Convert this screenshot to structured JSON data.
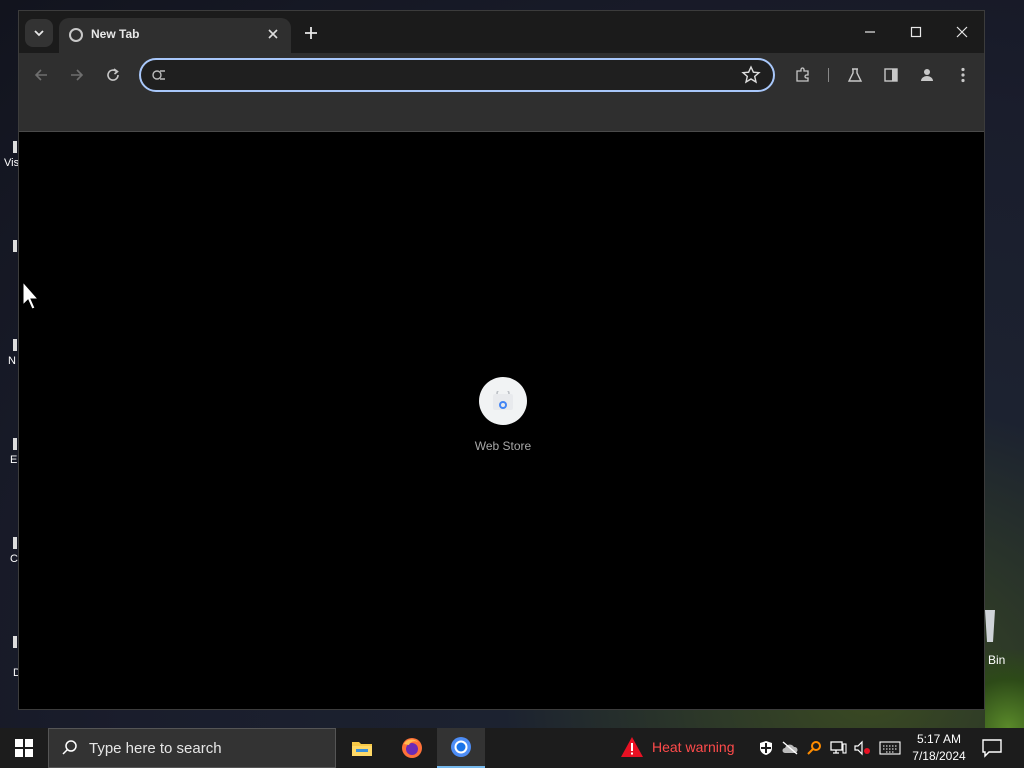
{
  "desktop": {
    "left_labels": [
      "Vis",
      "N",
      "E",
      "C",
      "D"
    ],
    "recycle_bin_label": "Bin"
  },
  "browser": {
    "tab": {
      "title": "New Tab",
      "close_icon": "close-icon"
    },
    "window_controls": [
      "minimize",
      "maximize",
      "close"
    ],
    "omnibox": {
      "value": "",
      "placeholder": ""
    },
    "new_tab_page": {
      "shortcuts": [
        {
          "label": "Web Store"
        }
      ]
    }
  },
  "taskbar": {
    "search_placeholder": "Type here to search",
    "apps": [
      "File Explorer",
      "Firefox",
      "Chrome"
    ],
    "weather": {
      "label": "Heat warning",
      "color": "#ff4b4b"
    },
    "clock": {
      "time": "5:17 AM",
      "date": "7/18/2024"
    }
  },
  "colors": {
    "omnibox_focus": "#a8c7fa",
    "taskbar_active": "#76b9ed"
  }
}
